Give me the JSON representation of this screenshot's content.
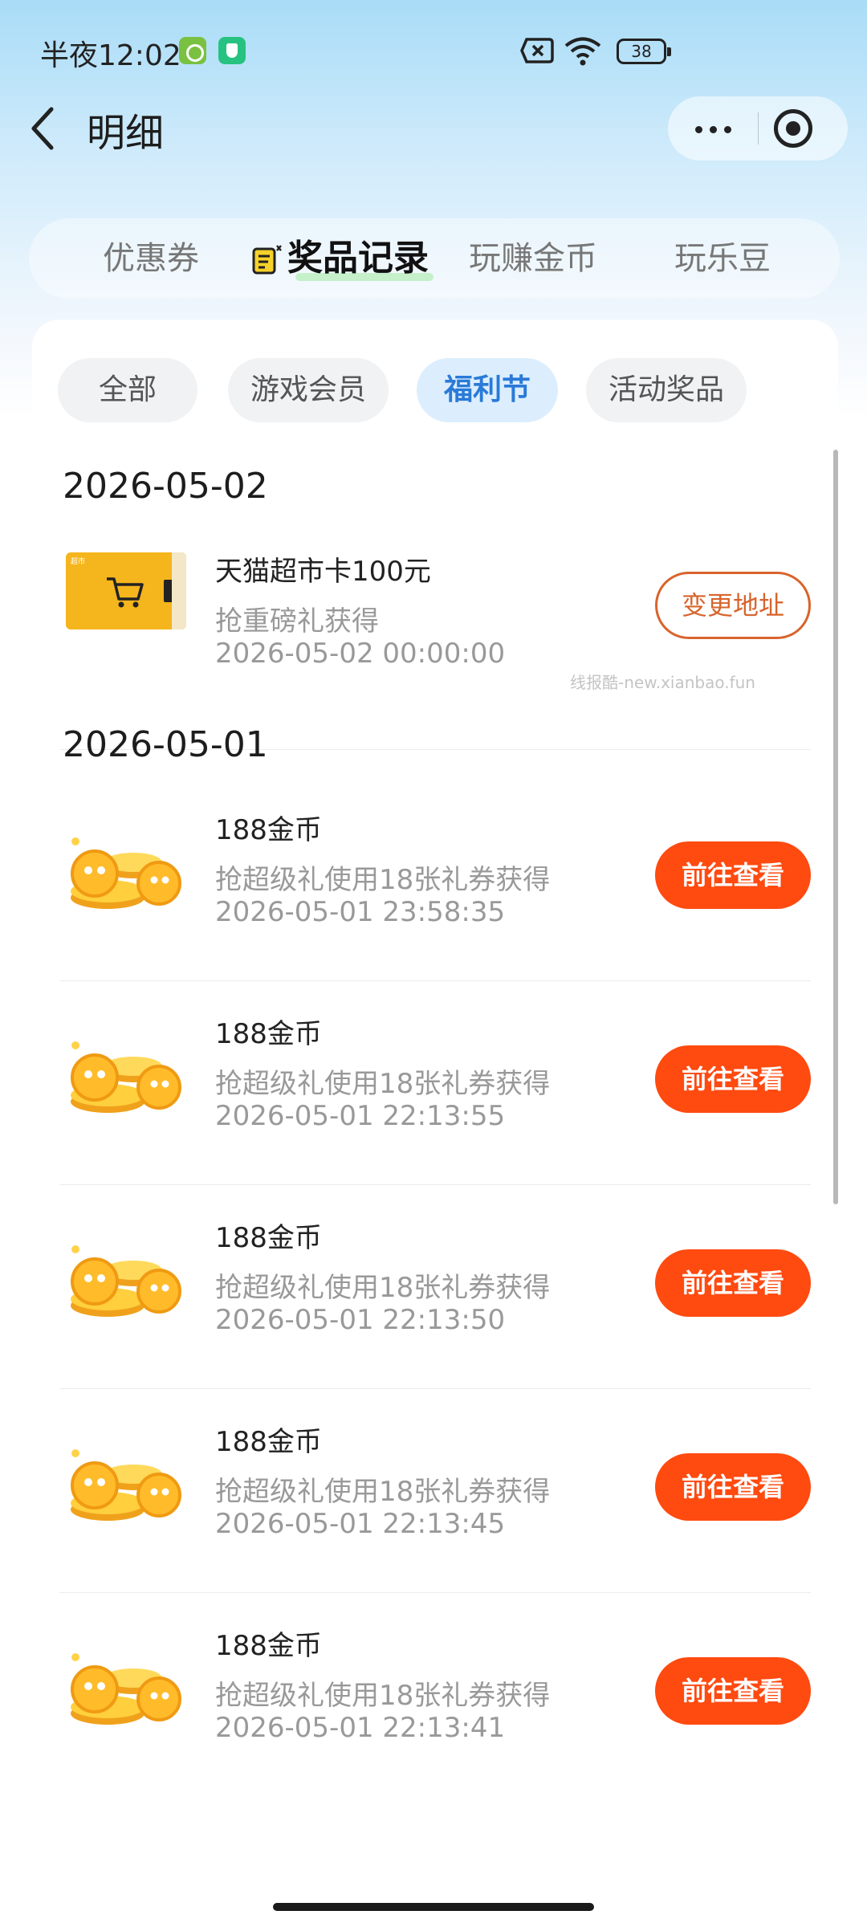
{
  "status_bar": {
    "time": "半夜12:02",
    "battery": "38",
    "icons": [
      "android-robot-icon",
      "shield-app-icon",
      "sim-off-icon",
      "wifi-icon",
      "battery-icon"
    ]
  },
  "nav": {
    "title": "明细",
    "back_icon": "back-arrow-icon",
    "more_icon": "more-dots-icon",
    "close_icon": "target-close-icon"
  },
  "main_tabs": [
    {
      "label": "优惠券",
      "active": false
    },
    {
      "label": "奖品记录",
      "active": true
    },
    {
      "label": "玩赚金币",
      "active": false
    },
    {
      "label": "玩乐豆",
      "active": false
    }
  ],
  "filter_chips": [
    {
      "label": "全部",
      "active": false
    },
    {
      "label": "游戏会员",
      "active": false
    },
    {
      "label": "福利节",
      "active": true
    },
    {
      "label": "活动奖品",
      "active": false
    }
  ],
  "groups": [
    {
      "date": "2026-05-02",
      "records": [
        {
          "name": "天猫超市卡100元",
          "desc": "抢重磅礼获得",
          "time": "2026-05-02 00:00:00",
          "button": "变更地址",
          "thumb": "gift-card-icon"
        }
      ]
    },
    {
      "date": "2026-05-01",
      "records": [
        {
          "name": "188金币",
          "desc": "抢超级礼使用18张礼券获得",
          "time": "2026-05-01 23:58:35",
          "button": "前往查看",
          "thumb": "gold-coins-icon"
        },
        {
          "name": "188金币",
          "desc": "抢超级礼使用18张礼券获得",
          "time": "2026-05-01 22:13:55",
          "button": "前往查看",
          "thumb": "gold-coins-icon"
        },
        {
          "name": "188金币",
          "desc": "抢超级礼使用18张礼券获得",
          "time": "2026-05-01 22:13:50",
          "button": "前往查看",
          "thumb": "gold-coins-icon"
        },
        {
          "name": "188金币",
          "desc": "抢超级礼使用18张礼券获得",
          "time": "2026-05-01 22:13:45",
          "button": "前往查看",
          "thumb": "gold-coins-icon"
        },
        {
          "name": "188金币",
          "desc": "抢超级礼使用18张礼券获得",
          "time": "2026-05-01 22:13:41",
          "button": "前往查看",
          "thumb": "gold-coins-icon"
        }
      ]
    }
  ],
  "watermark": "线报酷-new.xianbao.fun",
  "colors": {
    "accent_orange": "#ff4a10",
    "outline_orange": "#d8642c",
    "chip_active_text": "#2a7ad8",
    "chip_active_bg": "#dceefd",
    "tab_highlight": "#9fe7a6"
  }
}
